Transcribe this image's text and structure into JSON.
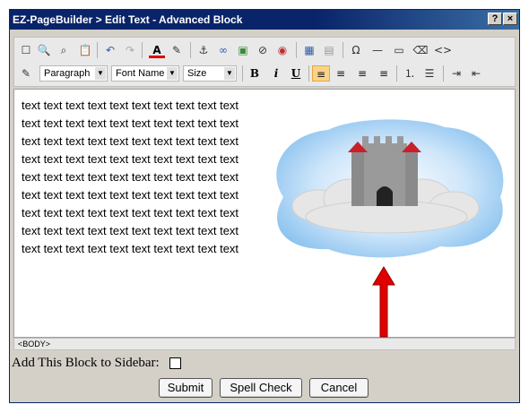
{
  "window": {
    "title": "EZ-PageBuilder > Edit Text - Advanced Block",
    "help_label": "?",
    "close_label": "×"
  },
  "toolbar": {
    "row1_icons": [
      "new-page-icon",
      "preview-icon",
      "find-icon",
      "paste-icon",
      "undo-icon",
      "redo-icon",
      "text-color-icon",
      "background-color-icon",
      "anchor-icon",
      "link-icon",
      "image-icon",
      "flash-icon",
      "media-icon",
      "table-icon",
      "cell-properties-icon",
      "special-char-icon",
      "horizontal-rule-icon",
      "form-icon",
      "eraser-icon",
      "source-icon"
    ],
    "format_select": "Paragraph",
    "font_select": "Font Name",
    "size_select": "Size",
    "bold": "B",
    "italic": "i",
    "underline": "U"
  },
  "editor": {
    "lines": [
      "text text text text text text text text text text",
      "text text text text text text text text text text",
      "text text text text text text text text text text",
      "text text text text text text text text text text",
      "text text text text text text text text text text",
      "text text text text text text text text text text",
      "text text text text text text text text text text",
      "text text text text text text text text text text",
      "text text text text text text text text text text"
    ],
    "status_path": "<BODY>"
  },
  "form": {
    "sidebar_label": "Add This Block to Sidebar:",
    "sidebar_checked": false
  },
  "buttons": {
    "submit": "Submit",
    "spellcheck": "Spell Check",
    "cancel": "Cancel"
  },
  "colors": {
    "titlebar": "#0a246a",
    "active_button": "#f9d38a",
    "arrow": "#e00000",
    "sky": "#a8d4f5"
  }
}
